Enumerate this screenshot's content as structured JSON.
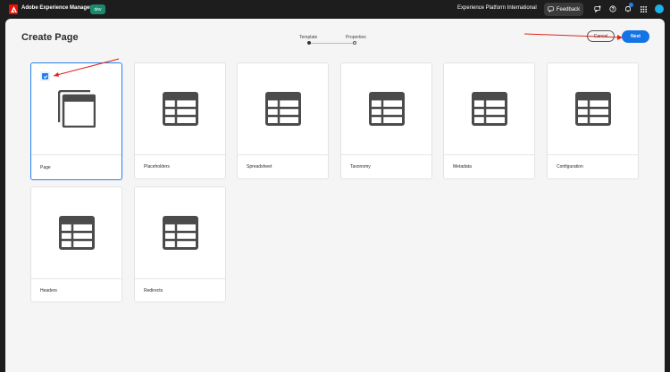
{
  "topbar": {
    "app_title": "Adobe Experience Manager",
    "env_badge": "dev",
    "org_name": "Experience Platform International",
    "feedback_label": "Feedback"
  },
  "header": {
    "title": "Create Page",
    "steps": [
      {
        "label": "Template",
        "active": true
      },
      {
        "label": "Properties",
        "active": false
      }
    ],
    "cancel_label": "Cancel",
    "next_label": "Next"
  },
  "templates": [
    {
      "label": "Page",
      "selected": true
    },
    {
      "label": "Placeholders",
      "selected": false
    },
    {
      "label": "Spreadsheet",
      "selected": false
    },
    {
      "label": "Taxonomy",
      "selected": false
    },
    {
      "label": "Metadata",
      "selected": false
    },
    {
      "label": "Configuration",
      "selected": false
    },
    {
      "label": "Headers",
      "selected": false
    },
    {
      "label": "Redirects",
      "selected": false
    }
  ],
  "colors": {
    "accent": "#1473e6",
    "annotation_arrow": "#e0241d",
    "topbar": "#1d1d1d",
    "badge": "#1a8a6e"
  }
}
